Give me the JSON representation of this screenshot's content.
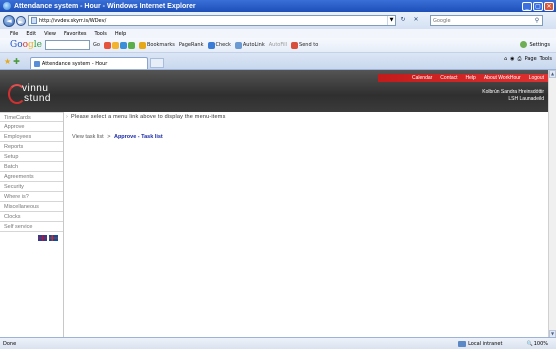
{
  "window": {
    "title": "Attendance system - Hour - Windows Internet Explorer"
  },
  "address": {
    "url": "http://vvdev.skyrr.is/WDev/"
  },
  "search": {
    "placeholder": "Google"
  },
  "menubar": {
    "items": [
      "File",
      "Edit",
      "View",
      "Favorites",
      "Tools",
      "Help"
    ]
  },
  "googlebar": {
    "logo_parts": [
      "Go",
      "o",
      "g",
      "le"
    ],
    "go": "Go",
    "bookmarks": "Bookmarks",
    "pagerank": "PageRank",
    "check": "Check",
    "autolink": "AutoLink",
    "autofill": "AutoFill",
    "sendto": "Send to",
    "settings": "Settings"
  },
  "tab": {
    "label": "Attendance system - Hour"
  },
  "commandbar": {
    "page": "Page",
    "tools": "Tools"
  },
  "app": {
    "top_links": [
      "Calendar",
      "Contact",
      "Help",
      "About WorkHour",
      "Logout"
    ],
    "logo_line1": "vinnu",
    "logo_line2": "stund",
    "user_name": "Kolbrún Sandra Hreinsdóttir",
    "user_org": "LSH Launadeild",
    "sidebar": [
      "TimeCards",
      "Approve",
      "Employees",
      "Reports",
      "Setup",
      "Batch",
      "Agreements",
      "Security",
      "Where is?",
      "Miscellaneous",
      "Clocks",
      "Self service"
    ],
    "notice": "Please select a menu link above to display the menu-items",
    "breadcrumb_root": "View task list",
    "breadcrumb_sep": ">",
    "breadcrumb_current": "Approve - Task list"
  },
  "statusbar": {
    "status": "Done",
    "zone": "Local intranet",
    "zoom": "100%"
  }
}
